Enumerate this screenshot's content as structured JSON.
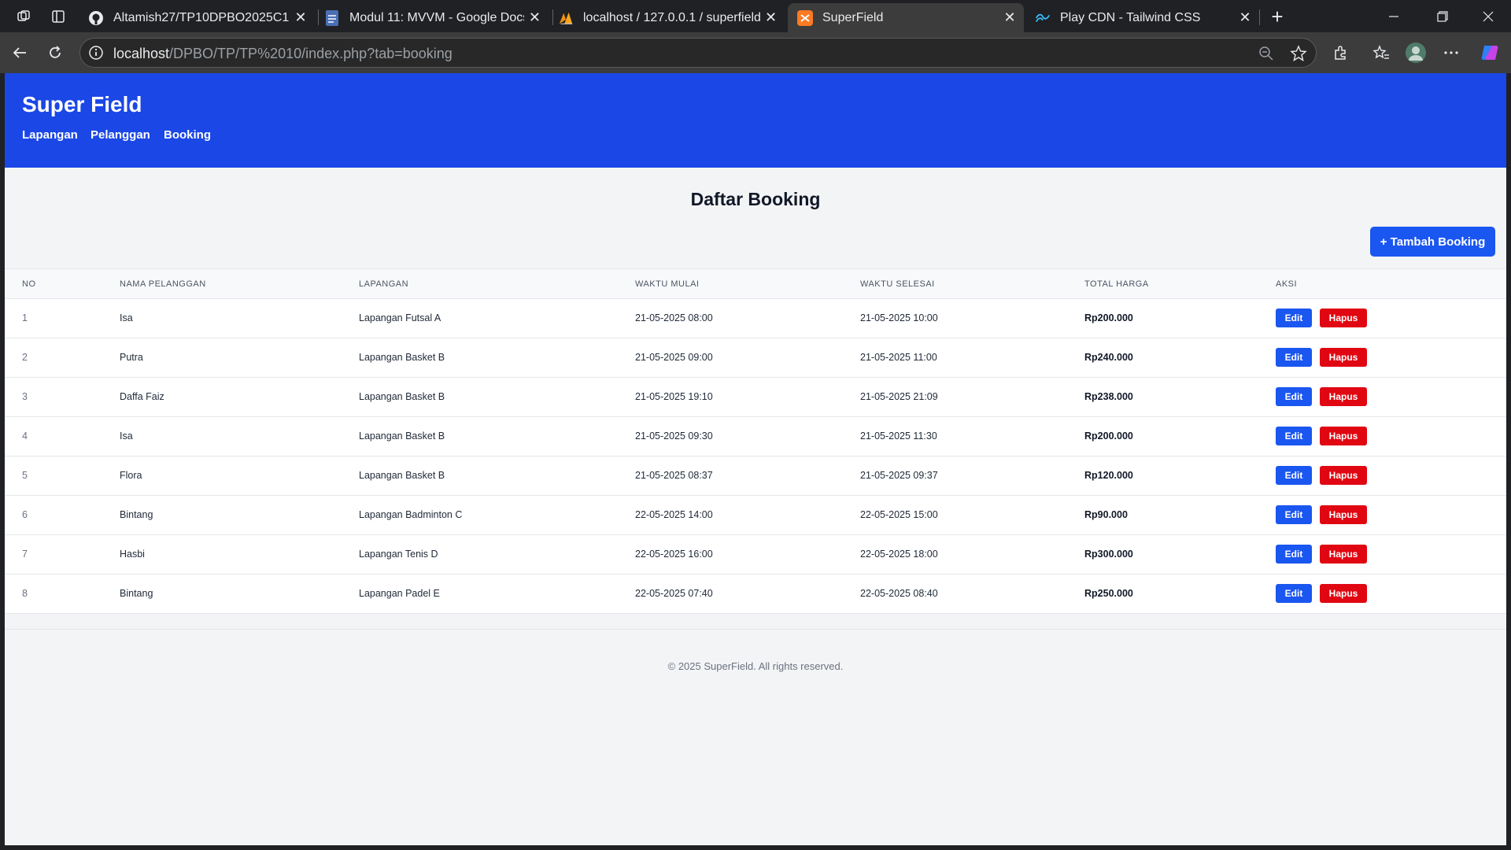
{
  "browser": {
    "tabs": [
      {
        "title": "Altamish27/TP10DPBO2025C1",
        "icon": "github-icon"
      },
      {
        "title": "Modul 11: MVVM - Google Docs",
        "icon": "google-docs-icon"
      },
      {
        "title": "localhost / 127.0.0.1 / superfield /",
        "icon": "phpmyadmin-icon"
      },
      {
        "title": "SuperField",
        "icon": "xampp-icon"
      },
      {
        "title": "Play CDN - Tailwind CSS",
        "icon": "tailwind-icon"
      }
    ],
    "close_glyph": "✕",
    "new_tab_glyph": "+",
    "url_host": "localhost",
    "url_path": "/DPBO/TP/TP%2010/index.php?tab=booking"
  },
  "site": {
    "brand": "Super Field",
    "nav": [
      "Lapangan",
      "Pelanggan",
      "Booking"
    ],
    "page_title": "Daftar Booking",
    "add_button": "+ Tambah Booking",
    "footer": "© 2025 SuperField. All rights reserved."
  },
  "table": {
    "headers": [
      "NO",
      "NAMA PELANGGAN",
      "LAPANGAN",
      "WAKTU MULAI",
      "WAKTU SELESAI",
      "TOTAL HARGA",
      "AKSI"
    ],
    "edit_label": "Edit",
    "delete_label": "Hapus",
    "rows": [
      {
        "no": "1",
        "nama": "Isa",
        "lapangan": "Lapangan Futsal A",
        "mulai": "21-05-2025 08:00",
        "selesai": "21-05-2025 10:00",
        "harga": "Rp200.000"
      },
      {
        "no": "2",
        "nama": "Putra",
        "lapangan": "Lapangan Basket B",
        "mulai": "21-05-2025 09:00",
        "selesai": "21-05-2025 11:00",
        "harga": "Rp240.000"
      },
      {
        "no": "3",
        "nama": "Daffa Faiz",
        "lapangan": "Lapangan Basket B",
        "mulai": "21-05-2025 19:10",
        "selesai": "21-05-2025 21:09",
        "harga": "Rp238.000"
      },
      {
        "no": "4",
        "nama": "Isa",
        "lapangan": "Lapangan Basket B",
        "mulai": "21-05-2025 09:30",
        "selesai": "21-05-2025 11:30",
        "harga": "Rp200.000"
      },
      {
        "no": "5",
        "nama": "Flora",
        "lapangan": "Lapangan Basket B",
        "mulai": "21-05-2025 08:37",
        "selesai": "21-05-2025 09:37",
        "harga": "Rp120.000"
      },
      {
        "no": "6",
        "nama": "Bintang",
        "lapangan": "Lapangan Badminton C",
        "mulai": "22-05-2025 14:00",
        "selesai": "22-05-2025 15:00",
        "harga": "Rp90.000"
      },
      {
        "no": "7",
        "nama": "Hasbi",
        "lapangan": "Lapangan Tenis D",
        "mulai": "22-05-2025 16:00",
        "selesai": "22-05-2025 18:00",
        "harga": "Rp300.000"
      },
      {
        "no": "8",
        "nama": "Bintang",
        "lapangan": "Lapangan Padel E",
        "mulai": "22-05-2025 07:40",
        "selesai": "22-05-2025 08:40",
        "harga": "Rp250.000"
      }
    ]
  },
  "colors": {
    "header_bg": "#1a47e6",
    "primary_button": "#1a56f0",
    "danger_button": "#e00712"
  }
}
